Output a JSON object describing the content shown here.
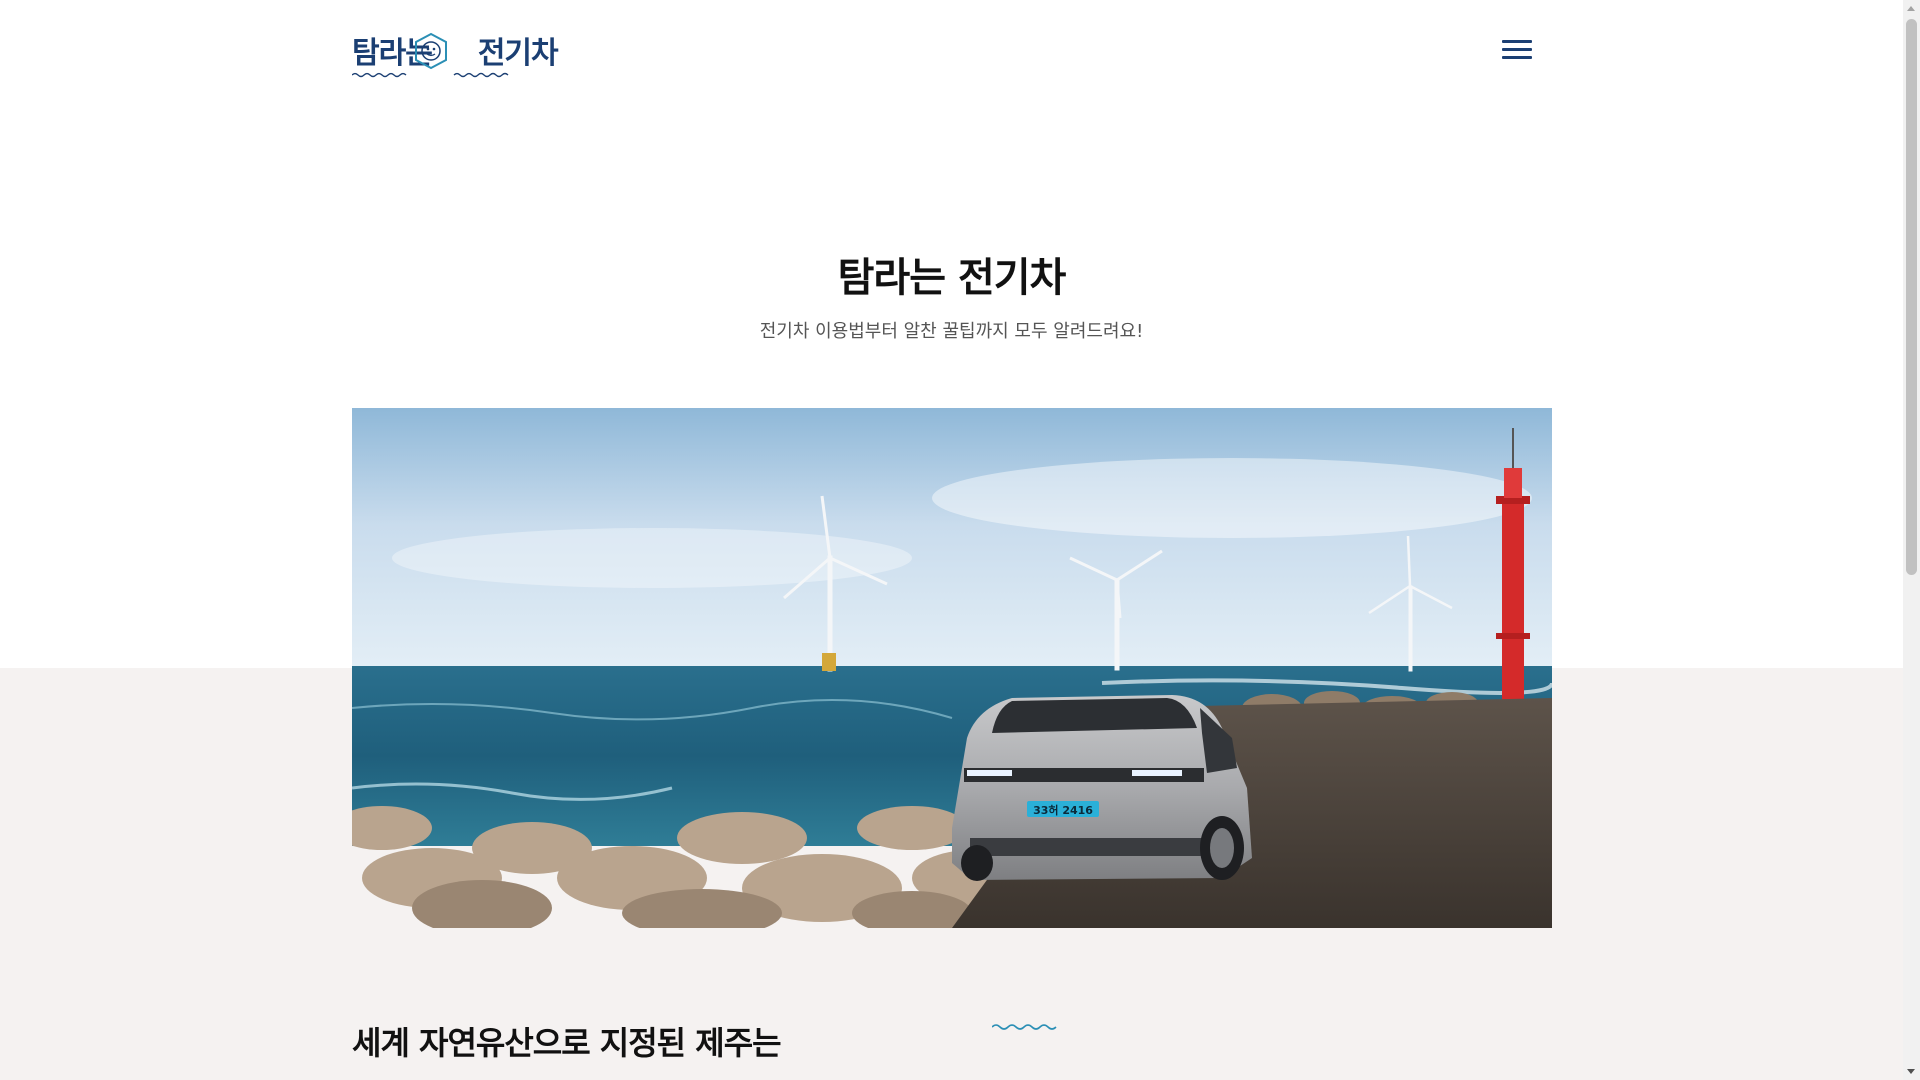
{
  "header": {
    "logo_text_left": "탐라는",
    "logo_text_right": "전기차",
    "logo_alt": "탐라는 전기차",
    "menu_icon": "hamburger-menu-icon"
  },
  "hero": {
    "title": "탐라는 전기차",
    "subtitle": "전기차 이용법부터 알찬 꿀팁까지 모두 알려드려요!",
    "image_subject": "electric-car-coast-wind-turbines",
    "license_plate": "33허 2416"
  },
  "content": {
    "heading_line1": "세계 자연유산으로 지정된 제주는",
    "heading_line2": "",
    "right_text": ""
  },
  "colors": {
    "brand": "#1b3f73",
    "band_background": "#f5f2f1",
    "sea_accent": "#2b8fb5"
  }
}
